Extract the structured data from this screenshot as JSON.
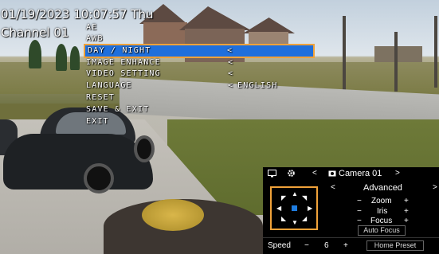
{
  "osd": {
    "datetime": "01/19/2023 10:07:57 Thu",
    "channel": "Channel 01"
  },
  "menu": {
    "items": [
      {
        "label": "AE",
        "arrow": "",
        "value": ""
      },
      {
        "label": "AWB",
        "arrow": "",
        "value": ""
      },
      {
        "label": "DAY / NIGHT",
        "arrow": "<",
        "value": "",
        "selected": true
      },
      {
        "label": "IMAGE ENHANCE",
        "arrow": "<",
        "value": ""
      },
      {
        "label": "VIDEO SETTING",
        "arrow": "<",
        "value": ""
      },
      {
        "label": "LANGUAGE",
        "arrow": "<",
        "value": "ENGLISH"
      },
      {
        "label": "RESET",
        "arrow": "",
        "value": ""
      },
      {
        "label": "SAVE & EXIT",
        "arrow": "",
        "value": ""
      },
      {
        "label": "EXIT",
        "arrow": "",
        "value": ""
      }
    ]
  },
  "ptz": {
    "camera_name": "Camera 01",
    "prev_camera": "<",
    "next_camera": ">",
    "mode_title": "Advanced",
    "mode_prev": "<",
    "mode_next": ">",
    "zoom": {
      "minus": "−",
      "label": "Zoom",
      "plus": "+"
    },
    "iris": {
      "minus": "−",
      "label": "Iris",
      "plus": "+"
    },
    "focus": {
      "minus": "−",
      "label": "Focus",
      "plus": "+"
    },
    "auto_focus": "Auto Focus",
    "speed_label": "Speed",
    "speed_minus": "−",
    "speed_value": "6",
    "speed_plus": "+",
    "home_preset": "Home Preset",
    "icons": [
      "monitor-icon",
      "gear-icon",
      "camera-icon"
    ]
  },
  "colors": {
    "highlight": "#1f6fdc",
    "focus_outline": "#f0a23a",
    "ptz_center": "#1f7de0"
  }
}
